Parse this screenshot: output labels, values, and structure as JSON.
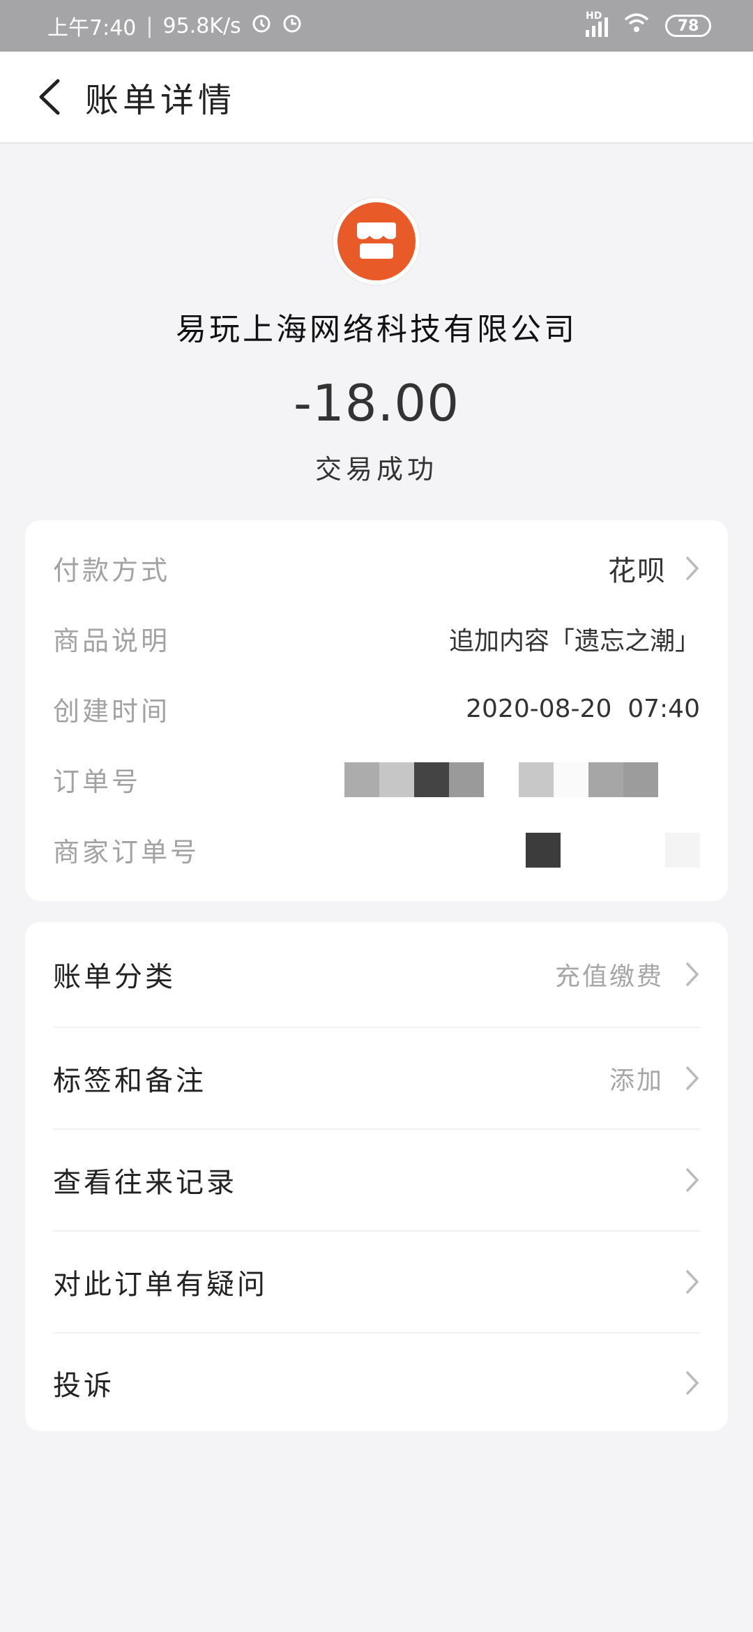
{
  "status_bar": {
    "time": "上午7:40",
    "net_speed": "95.8K/s",
    "network_type": "HD",
    "battery": "78",
    "icons": [
      "alarm-icon",
      "clock-icon",
      "signal-icon",
      "wifi-icon",
      "battery-icon"
    ]
  },
  "header": {
    "title": "账单详情",
    "back_icon": "chevron-left-icon"
  },
  "summary": {
    "merchant_name": "易玩上海网络科技有限公司",
    "amount": "-18.00",
    "status": "交易成功",
    "logo_icon": "storefront-icon",
    "logo_color": "#e85a27"
  },
  "details": {
    "payment_method_label": "付款方式",
    "payment_method_value": "花呗",
    "product_desc_label": "商品说明",
    "product_desc_value": "追加内容「遗忘之潮」",
    "created_time_label": "创建时间",
    "created_time_value": "2020-08-20  07:40",
    "order_no_label": "订单号",
    "merchant_order_no_label": "商家订单号"
  },
  "actions": [
    {
      "label": "账单分类",
      "value": "充值缴费"
    },
    {
      "label": "标签和备注",
      "value": "添加"
    },
    {
      "label": "查看往来记录",
      "value": ""
    },
    {
      "label": "对此订单有疑问",
      "value": ""
    },
    {
      "label": "投诉",
      "value": ""
    }
  ],
  "colors": {
    "status_bar_bg": "#a5a5a7",
    "page_bg": "#f4f4f6",
    "accent": "#e85a27"
  }
}
